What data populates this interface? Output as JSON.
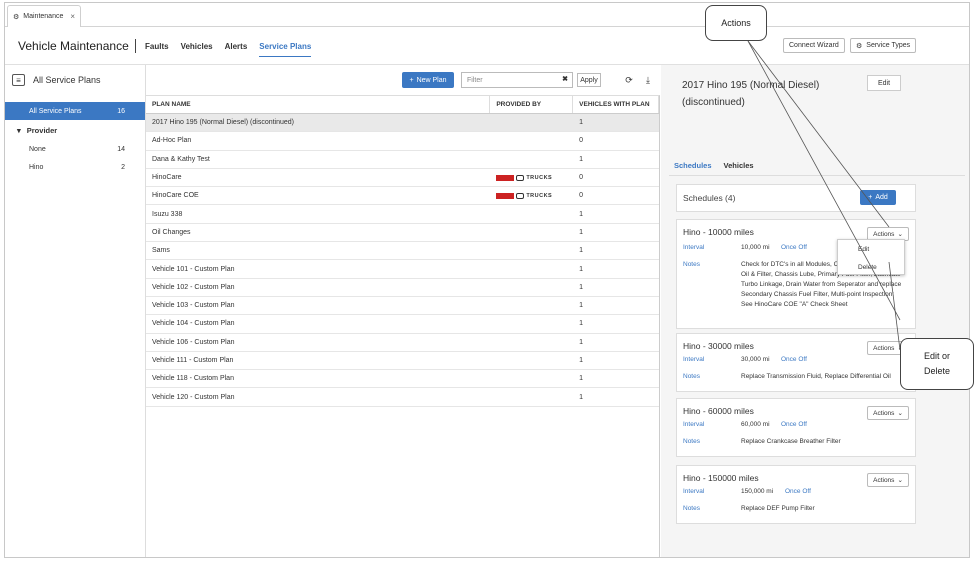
{
  "browser_tab": {
    "label": "Maintenance"
  },
  "header": {
    "title": "Vehicle Maintenance",
    "nav": [
      "Faults",
      "Vehicles",
      "Alerts",
      "Service Plans"
    ],
    "connect_wizard": "Connect Wizard",
    "service_types": "Service Types"
  },
  "toolbar": {
    "title": "All Service Plans",
    "new_plan": "New Plan",
    "filter_placeholder": "Filter",
    "apply": "Apply"
  },
  "sidebar": {
    "all_label": "All Service Plans",
    "all_count": "16",
    "provider_label": "Provider",
    "providers": [
      {
        "label": "None",
        "count": "14"
      },
      {
        "label": "Hino",
        "count": "2"
      }
    ]
  },
  "table": {
    "columns": [
      "PLAN NAME",
      "PROVIDED BY",
      "VEHICLES WITH PLAN"
    ],
    "logo_text": "TRUCKS",
    "rows": [
      {
        "name": "2017 Hino 195 (Normal Diesel) (discontinued)",
        "count": "1"
      },
      {
        "name": "Ad-Hoc Plan",
        "count": "0"
      },
      {
        "name": "Dana & Kathy Test",
        "count": "1"
      },
      {
        "name": "HinoCare",
        "count": "0"
      },
      {
        "name": "HinoCare COE",
        "count": "0"
      },
      {
        "name": "Isuzu 338",
        "count": "1"
      },
      {
        "name": "Oil Changes",
        "count": "1"
      },
      {
        "name": "Sams",
        "count": "1"
      },
      {
        "name": "Vehicle 101 - Custom Plan",
        "count": "1"
      },
      {
        "name": "Vehicle 102 - Custom Plan",
        "count": "1"
      },
      {
        "name": "Vehicle 103 - Custom Plan",
        "count": "1"
      },
      {
        "name": "Vehicle 104 - Custom Plan",
        "count": "1"
      },
      {
        "name": "Vehicle 106 - Custom Plan",
        "count": "1"
      },
      {
        "name": "Vehicle 111 - Custom Plan",
        "count": "1"
      },
      {
        "name": "Vehicle 118 - Custom Plan",
        "count": "1"
      },
      {
        "name": "Vehicle 120 - Custom Plan",
        "count": "1"
      }
    ]
  },
  "detail": {
    "title": "2017 Hino 195 (Normal Diesel) (discontinued)",
    "edit": "Edit",
    "tabs": [
      "Schedules",
      "Vehicles"
    ],
    "schedules_header": "Schedules (4)",
    "add": "Add",
    "interval_label": "Interval",
    "notes_label": "Notes",
    "actions_label": "Actions",
    "schedules": [
      {
        "name": "Hino - 10000 miles",
        "interval": "10,000 mi",
        "type": "Once Off",
        "notes": "Check for DTC's in all Modules, Check/Replace Engine Oil & Filter, Chassis Lube, Primary Fuel Filter, Lubricate Turbo Linkage, Drain Water from Seperator and replace Secondary Chassis Fuel Filter, Multi-point Inspection: See HinoCare COE \"A\" Check Sheet"
      },
      {
        "name": "Hino - 30000 miles",
        "interval": "30,000 mi",
        "type": "Once Off",
        "notes": "Replace Transmission Fluid, Replace Differential Oil"
      },
      {
        "name": "Hino - 60000 miles",
        "interval": "60,000 mi",
        "type": "Once Off",
        "notes": "Replace Crankcase Breather Filter"
      },
      {
        "name": "Hino - 150000 miles",
        "interval": "150,000 mi",
        "type": "Once Off",
        "notes": "Replace DEF Pump Filter"
      }
    ],
    "menu": [
      "Edit",
      "Delete"
    ]
  },
  "callouts": {
    "actions": "Actions",
    "edit_delete": "Edit or Delete"
  },
  "colors": {
    "accent": "#3b78c3",
    "selected_row": "#e9e9e9"
  }
}
